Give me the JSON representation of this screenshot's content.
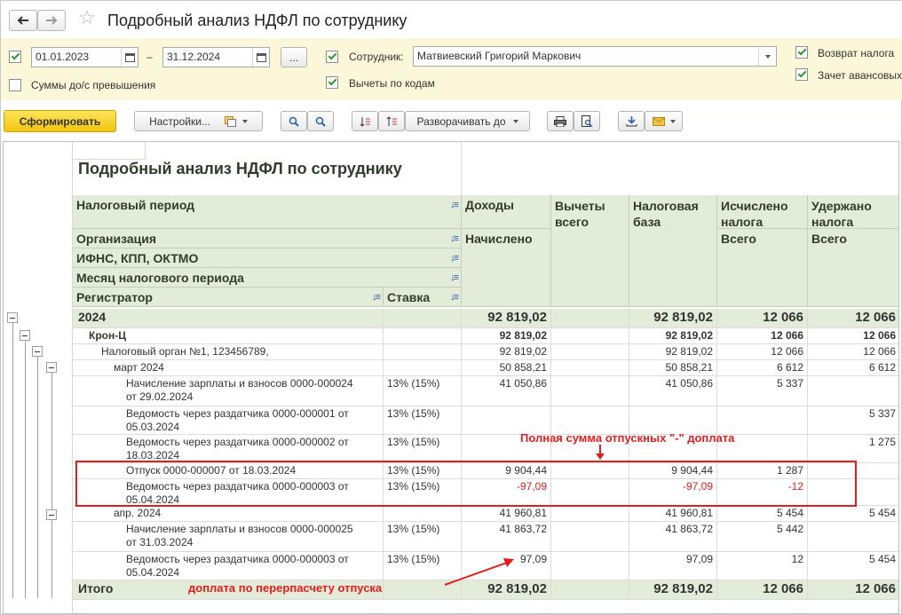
{
  "window": {
    "title": "Подробный анализ НДФЛ по сотруднику"
  },
  "params": {
    "date_from": "01.01.2023",
    "date_sep": "–",
    "date_to": "31.12.2024",
    "more_btn": "...",
    "employee_label": "Сотрудник:",
    "employee_value": "Матвиевский Григорий Маркович",
    "sums_over_label": "Суммы до/с превышения",
    "deductions_label": "Вычеты по кодам",
    "tax_return_label": "Возврат налога",
    "advance_offset_label": "Зачет авансовых"
  },
  "toolbar": {
    "generate": "Сформировать",
    "settings": "Настройки...",
    "expand": "Разворачивать до"
  },
  "report": {
    "title": "Подробный анализ НДФЛ по сотруднику",
    "headers": {
      "tax_period": "Налоговый период",
      "organization": "Организация",
      "ifns": "ИФНС, КПП, ОКТМО",
      "month": "Месяц налогового периода",
      "registrar": "Регистратор",
      "rate": "Ставка",
      "income": "Доходы",
      "income_sub": "Начислено",
      "deductions": "Вычеты всего",
      "taxbase": "Налоговая база",
      "calc": "Исчислено налога",
      "calc_sub": "Всего",
      "withheld": "Удержано налога",
      "withheld_sub": "Всего"
    },
    "rows": [
      {
        "name": "2024",
        "rate": "",
        "income": "92 819,02",
        "ded": "",
        "base": "92 819,02",
        "calc": "12 066",
        "held": "12 066"
      },
      {
        "name": "Крон-Ц",
        "rate": "",
        "income": "92 819,02",
        "ded": "",
        "base": "92 819,02",
        "calc": "12 066",
        "held": "12 066"
      },
      {
        "name": "Налоговый орган №1, 123456789,",
        "rate": "",
        "income": "92 819,02",
        "ded": "",
        "base": "92 819,02",
        "calc": "12 066",
        "held": "12 066"
      },
      {
        "name": "март 2024",
        "rate": "",
        "income": "50 858,21",
        "ded": "",
        "base": "50 858,21",
        "calc": "6 612",
        "held": "6 612"
      },
      {
        "name1": "Начисление зарплаты и взносов 0000-000024",
        "name2": "от 29.02.2024",
        "rate": "13% (15%)",
        "income": "41 050,86",
        "ded": "",
        "base": "41 050,86",
        "calc": "5 337",
        "held": ""
      },
      {
        "name1": "Ведомость через раздатчика 0000-000001 от",
        "name2": "05.03.2024",
        "rate": "13% (15%)",
        "income": "",
        "ded": "",
        "base": "",
        "calc": "",
        "held": "5 337"
      },
      {
        "name1": "Ведомость через раздатчика 0000-000002 от",
        "name2": "18.03.2024",
        "rate": "13% (15%)",
        "income": "",
        "ded": "",
        "base": "",
        "calc": "",
        "held": "1 275"
      },
      {
        "name": "Отпуск 0000-000007 от 18.03.2024",
        "rate": "13% (15%)",
        "income": "9 904,44",
        "ded": "",
        "base": "9 904,44",
        "calc": "1 287",
        "held": ""
      },
      {
        "name1": "Ведомость через раздатчика 0000-000003 от",
        "name2": "05.04.2024",
        "rate": "13% (15%)",
        "income": "-97,09",
        "ded": "",
        "base": "-97,09",
        "calc": "-12",
        "held": ""
      },
      {
        "name": "апр. 2024",
        "rate": "",
        "income": "41 960,81",
        "ded": "",
        "base": "41 960,81",
        "calc": "5 454",
        "held": "5 454"
      },
      {
        "name1": "Начисление зарплаты и взносов 0000-000025",
        "name2": "от 31.03.2024",
        "rate": "13% (15%)",
        "income": "41 863,72",
        "ded": "",
        "base": "41 863,72",
        "calc": "5 442",
        "held": ""
      },
      {
        "name1": "Ведомость через раздатчика 0000-000003 от",
        "name2": "05.04.2024",
        "rate": "13% (15%)",
        "income": "97,09",
        "ded": "",
        "base": "97,09",
        "calc": "12",
        "held": "5 454"
      },
      {
        "name": "Итого",
        "rate": "",
        "income": "92 819,02",
        "ded": "",
        "base": "92 819,02",
        "calc": "12 066",
        "held": "12 066"
      }
    ],
    "annotations": {
      "full_sum": "Полная сумма отпускных \"-\" доплата",
      "extra_pay": "доплата по перерпасчету отпуска"
    }
  },
  "colors": {
    "accent_yellow": "#f1c40f",
    "header_green": "#e3ecd8",
    "annotation_red": "#e31d1d"
  }
}
